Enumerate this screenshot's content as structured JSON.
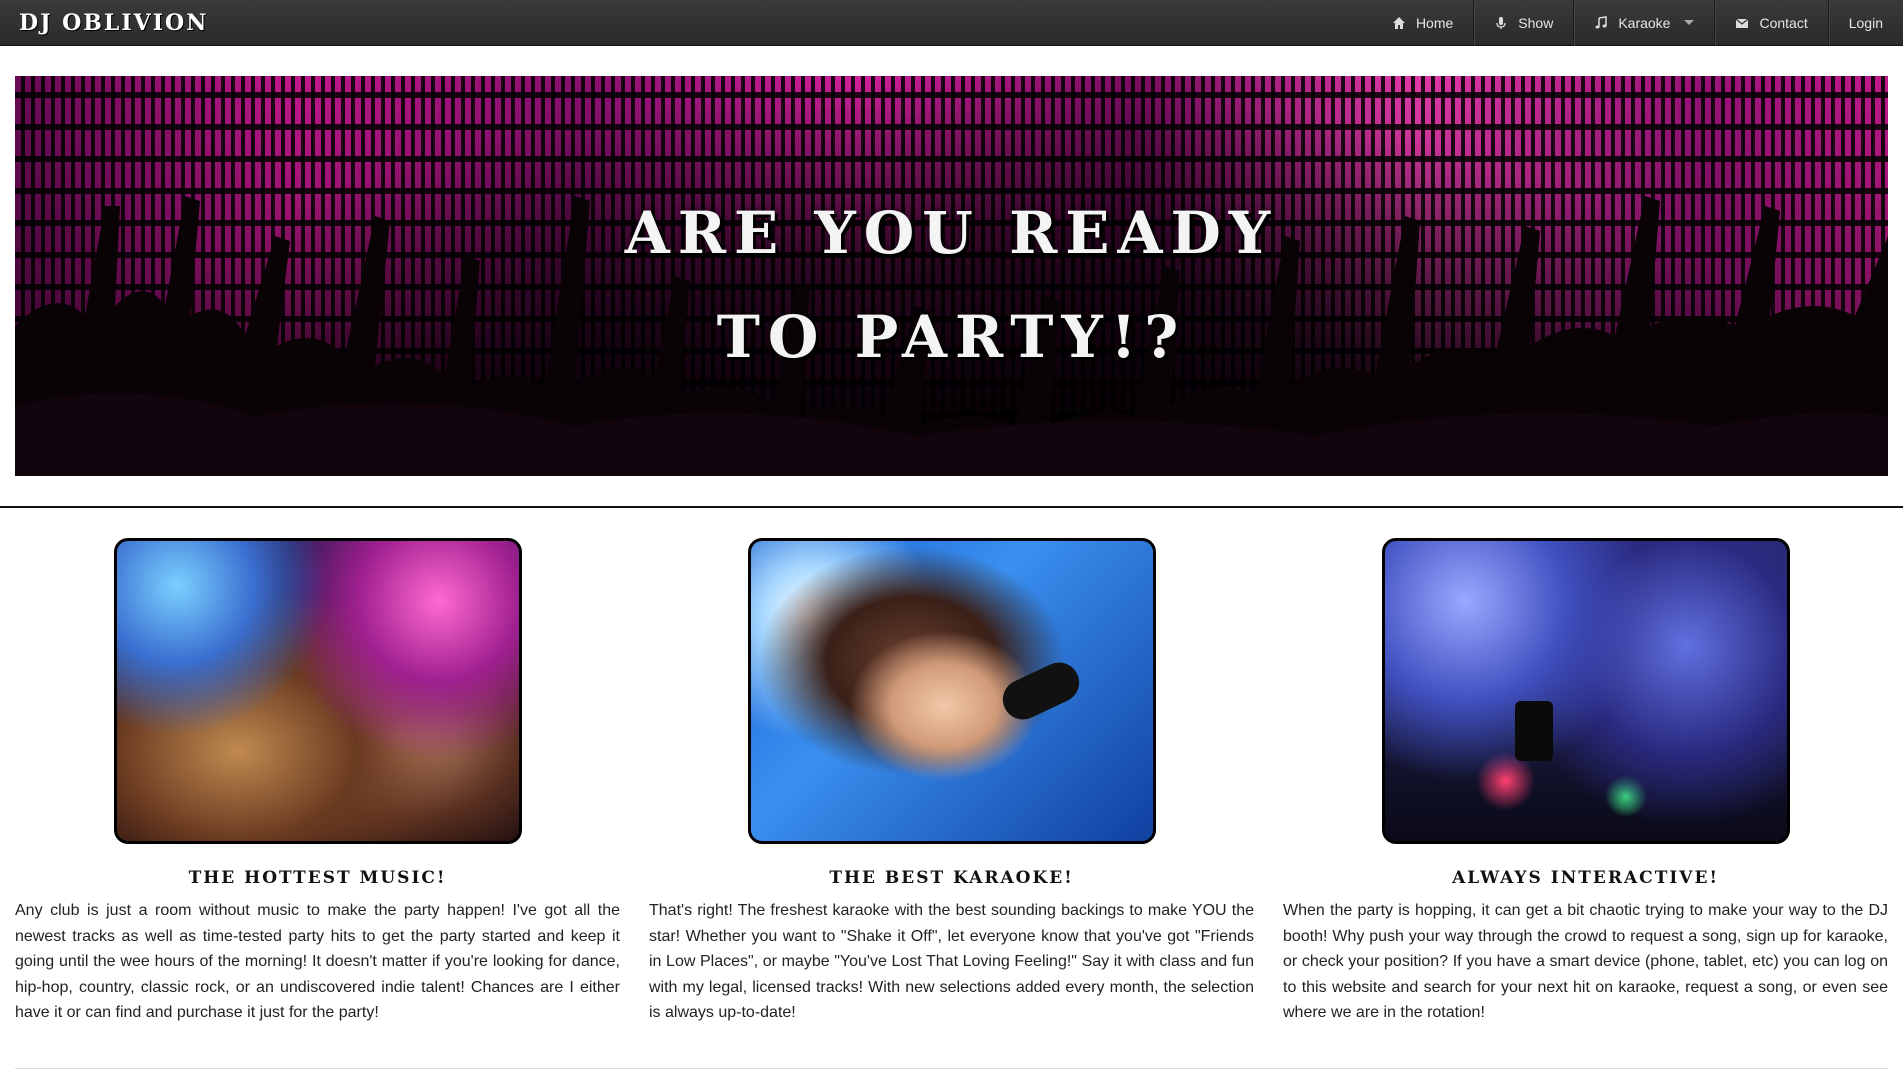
{
  "brand": "DJ OBLIVION",
  "nav": {
    "items": [
      {
        "label": "Home",
        "icon": "home-icon"
      },
      {
        "label": "Show",
        "icon": "microphone-icon"
      },
      {
        "label": "Karaoke",
        "icon": "music-note-icon",
        "dropdown": true
      },
      {
        "label": "Contact",
        "icon": "envelope-icon"
      },
      {
        "label": "Login"
      }
    ]
  },
  "hero": {
    "line1": "ARE YOU READY",
    "line2": "TO PARTY!?"
  },
  "features": [
    {
      "heading": "THE HOTTEST MUSIC!",
      "text": "Any club is just a room without music to make the party happen! I've got all the newest tracks as well as time-tested party hits to get the party started and keep it going until the wee hours of the morning! It doesn't matter if you're looking for dance, hip-hop, country, classic rock, or an undiscovered indie talent! Chances are I either have it or can find and purchase it just for the party!"
    },
    {
      "heading": "THE BEST KARAOKE!",
      "text": "That's right! The freshest karaoke with the best sounding backings to make YOU the star! Whether you want to \"Shake it Off\", let everyone know that you've got \"Friends in Low Places\", or maybe \"You've Lost That Loving Feeling!\" Say it with class and fun with my legal, licensed tracks! With new selections added every month, the selection is always up-to-date!"
    },
    {
      "heading": "ALWAYS INTERACTIVE!",
      "text": "When the party is hopping, it can get a bit chaotic trying to make your way to the DJ booth! Why push your way through the crowd to request a song, sign up for karaoke, or check your position? If you have a smart device (phone, tablet, etc) you can log on to this website and search for your next hit on karaoke, request a song, or even see where we are in the rotation!"
    }
  ],
  "colors": {
    "navbar": "#2f2f2f",
    "hero_accent": "#c2188c"
  }
}
